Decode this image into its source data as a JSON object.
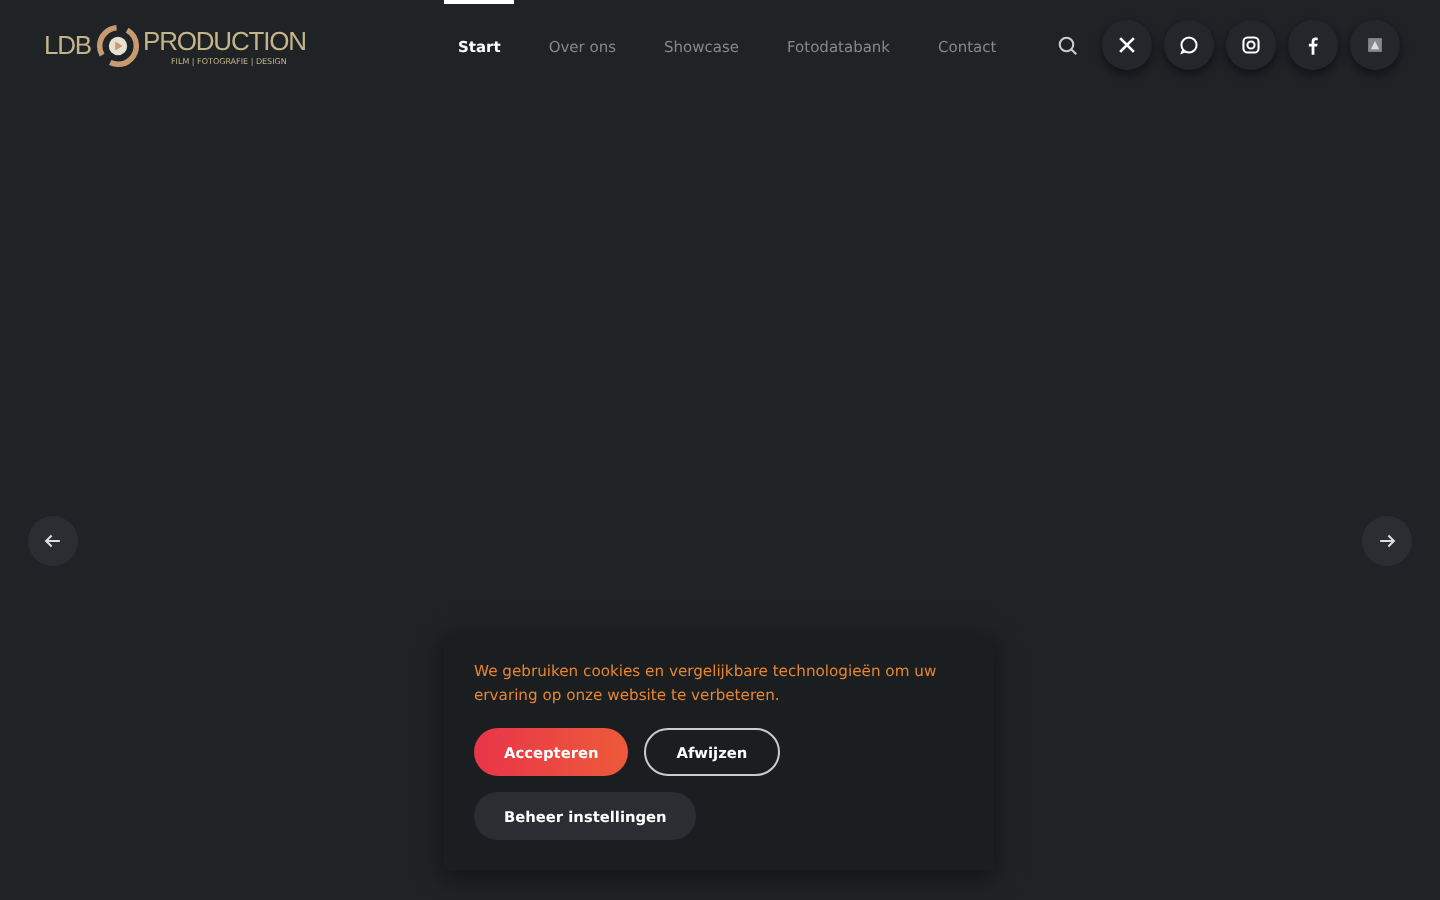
{
  "logo": {
    "left": "LDB",
    "right": "PRODUCTION",
    "tagline": "FILM | FOTOGRAFIE | DESIGN"
  },
  "nav": [
    {
      "label": "Start",
      "selected": true
    },
    {
      "label": "Over ons",
      "selected": false
    },
    {
      "label": "Showcase",
      "selected": false
    },
    {
      "label": "Fotodatabank",
      "selected": false
    },
    {
      "label": "Contact",
      "selected": false
    }
  ],
  "social": [
    {
      "kind": "x"
    },
    {
      "kind": "whatsapp"
    },
    {
      "kind": "instagram"
    },
    {
      "kind": "facebook"
    },
    {
      "kind": "app"
    }
  ],
  "cookie": {
    "text": "We gebruiken cookies en vergelijkbare technologieën om uw ervaring op onze website te verbeteren.",
    "buttons": [
      {
        "label": "Accepteren",
        "kind": "primary"
      },
      {
        "label": "Afwijzen",
        "kind": "outline"
      },
      {
        "label": "Beheer instellingen",
        "kind": "plain"
      }
    ]
  }
}
